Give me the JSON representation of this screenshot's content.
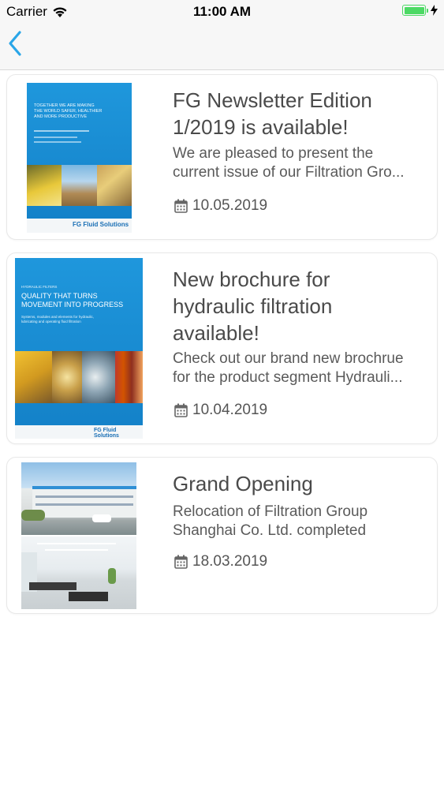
{
  "status_bar": {
    "carrier": "Carrier",
    "time": "11:00 AM",
    "battery_level": 1.0
  },
  "nav": {
    "back_icon": "chevron-left-icon",
    "accent_color": "#2aa6e8"
  },
  "news": [
    {
      "title_lines": [
        "FG Newsletter Edition",
        "1/2019 is available!"
      ],
      "desc_lines": [
        "We are pleased to present the",
        "current issue of our Filtration Gro..."
      ],
      "date": "10.05.2019",
      "thumb": {
        "headline_lines": [
          "TOGETHER WE ARE MAKING",
          "THE WORLD SAFER, HEALTHIER",
          "AND MORE PRODUCTIVE"
        ],
        "brand": "FG Fluid Solutions"
      }
    },
    {
      "title_lines": [
        "New brochure for",
        "hydraulic filtration",
        "available!"
      ],
      "desc_lines": [
        "Check out our brand new brochrue",
        "for the product segment Hydrauli..."
      ],
      "date": "10.04.2019",
      "thumb": {
        "kicker": "HYDRAULIC FILTERS",
        "headline_lines": [
          "QUALITY THAT TURNS",
          "MOVEMENT INTO PROGRESS"
        ],
        "sub_lines": [
          "Systems, modules and elements for hydraulic,",
          "lubricating and operating fluid filtration"
        ],
        "brand": "FG Fluid Solutions"
      }
    },
    {
      "title_lines": [
        "Grand Opening"
      ],
      "desc_lines": [
        "Relocation of Filtration Group",
        "Shanghai Co. Ltd. completed"
      ],
      "date": "18.03.2019",
      "thumb": {}
    }
  ]
}
